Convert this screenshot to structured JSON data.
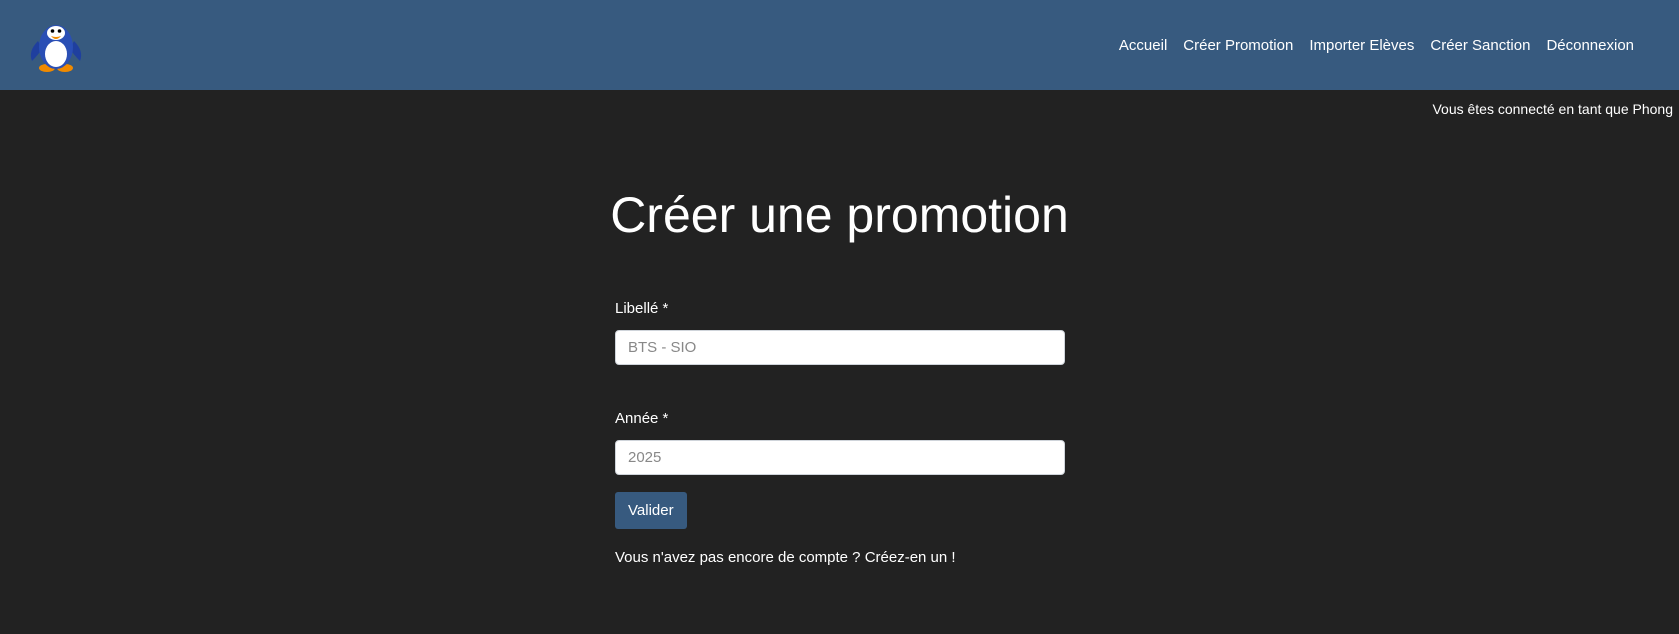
{
  "navbar": {
    "logo_icon": "penguin-logo-icon",
    "links": [
      "Accueil",
      "Créer Promotion",
      "Importer Elèves",
      "Créer Sanction",
      "Déconnexion"
    ]
  },
  "user_status": "Vous êtes connecté en tant que Phong",
  "page_title": "Créer une promotion",
  "form": {
    "libelle_label": "Libellé *",
    "libelle_placeholder": "BTS - SIO",
    "annee_label": "Année *",
    "annee_placeholder": "2025",
    "submit_label": "Valider"
  },
  "account_prompt": "Vous n'avez pas encore de compte ? Créez-en un !",
  "colors": {
    "navbar": "#375a7f",
    "background": "#222222",
    "button": "#375a7f"
  }
}
